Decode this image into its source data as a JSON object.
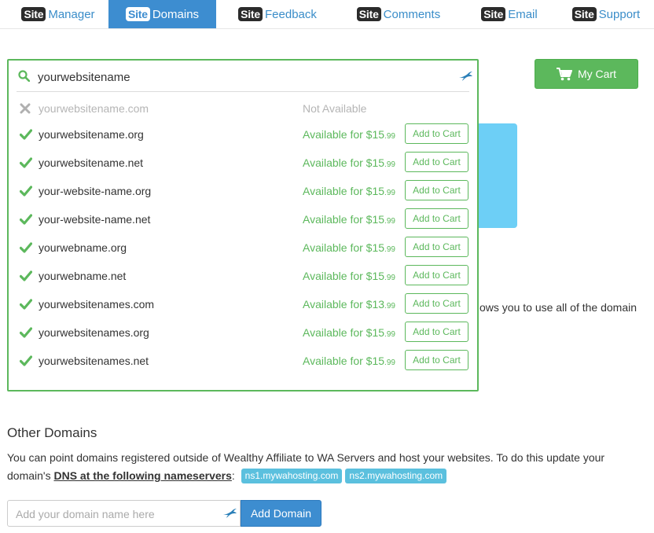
{
  "nav": {
    "tabs": [
      {
        "badge": "Site",
        "label": "Manager",
        "active": false
      },
      {
        "badge": "Site",
        "label": "Domains",
        "active": true
      },
      {
        "badge": "Site",
        "label": "Feedback",
        "active": false
      },
      {
        "badge": "Site",
        "label": "Comments",
        "active": false
      },
      {
        "badge": "Site",
        "label": "Email",
        "active": false
      },
      {
        "badge": "Site",
        "label": "Support",
        "active": false
      }
    ]
  },
  "cart": {
    "label": "My Cart",
    "icon": "shopping-cart-icon"
  },
  "background": {
    "partial_text": "ows you to use all of the domain"
  },
  "search": {
    "value": "yourwebsitename",
    "icon": "search-icon",
    "assist_icon": "bird-icon",
    "results": [
      {
        "domain": "yourwebsitename.com",
        "available": false,
        "status": "Not Available"
      },
      {
        "domain": "yourwebsitename.org",
        "available": true,
        "status": "Available for $15",
        "cents": ".99",
        "button": "Add to Cart"
      },
      {
        "domain": "yourwebsitename.net",
        "available": true,
        "status": "Available for $15",
        "cents": ".99",
        "button": "Add to Cart"
      },
      {
        "domain": "your-website-name.org",
        "available": true,
        "status": "Available for $15",
        "cents": ".99",
        "button": "Add to Cart"
      },
      {
        "domain": "your-website-name.net",
        "available": true,
        "status": "Available for $15",
        "cents": ".99",
        "button": "Add to Cart"
      },
      {
        "domain": "yourwebname.org",
        "available": true,
        "status": "Available for $15",
        "cents": ".99",
        "button": "Add to Cart"
      },
      {
        "domain": "yourwebname.net",
        "available": true,
        "status": "Available for $15",
        "cents": ".99",
        "button": "Add to Cart"
      },
      {
        "domain": "yourwebsitenames.com",
        "available": true,
        "status": "Available for $13",
        "cents": ".99",
        "button": "Add to Cart"
      },
      {
        "domain": "yourwebsitenames.org",
        "available": true,
        "status": "Available for $15",
        "cents": ".99",
        "button": "Add to Cart"
      },
      {
        "domain": "yourwebsitenames.net",
        "available": true,
        "status": "Available for $15",
        "cents": ".99",
        "button": "Add to Cart"
      }
    ]
  },
  "other": {
    "title": "Other Domains",
    "desc_part1": "You can point domains registered outside of Wealthy Affiliate to WA Servers and host your websites. To do this update your domain's ",
    "dns_link": "DNS at the following nameservers",
    "desc_colon": ":",
    "ns1": "ns1.mywahosting.com",
    "ns2": "ns2.mywahosting.com",
    "input_placeholder": "Add your domain name here",
    "add_button": "Add Domain"
  },
  "colors": {
    "accent_blue": "#3d8dd0",
    "success_green": "#5cb85c",
    "info_blue": "#5bc0de",
    "panel_blue": "#6dcff6"
  }
}
